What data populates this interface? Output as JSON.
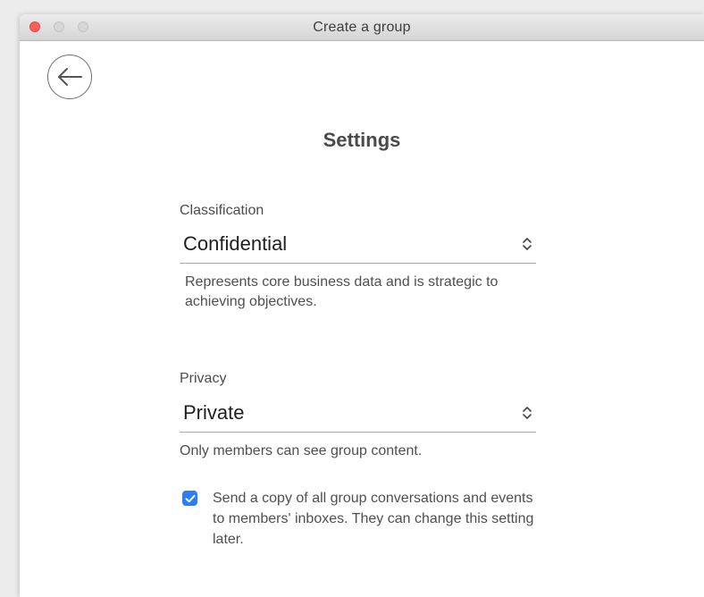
{
  "window": {
    "title": "Create a group"
  },
  "nav": {
    "back_icon": "arrow-left-icon"
  },
  "page": {
    "title": "Settings"
  },
  "classification": {
    "label": "Classification",
    "value": "Confidential",
    "description": "Represents core business data and is strategic to achieving objectives."
  },
  "privacy": {
    "label": "Privacy",
    "value": "Private",
    "description": "Only members can see group content."
  },
  "copy_option": {
    "checked": true,
    "label": "Send a copy of all group conversations and events to members' inboxes. They can change this setting later."
  },
  "colors": {
    "accent": "#2d7ef0",
    "close": "#fc5f57"
  }
}
